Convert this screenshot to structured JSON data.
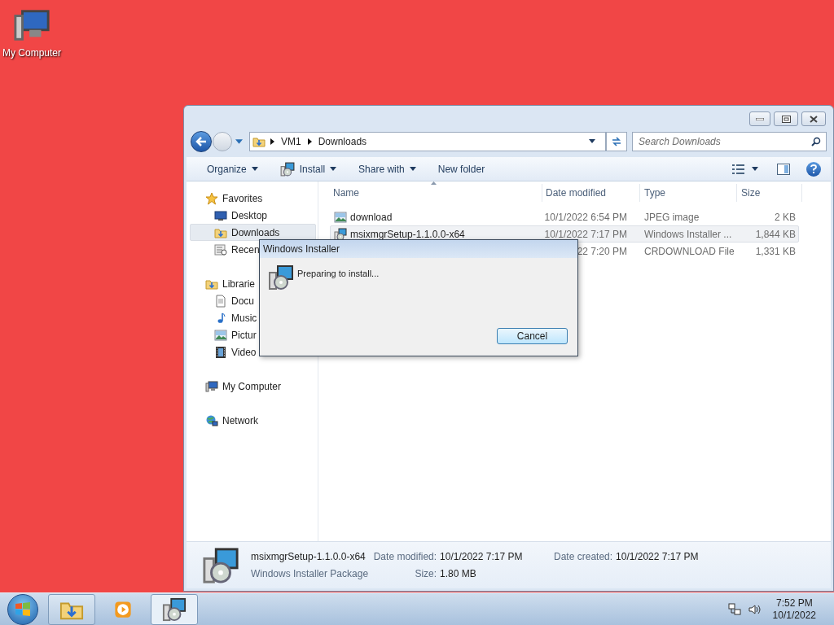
{
  "desktop": {
    "icons": [
      {
        "label": "My Computer",
        "kind": "computer"
      }
    ]
  },
  "explorer": {
    "address": [
      "VM1",
      "Downloads"
    ],
    "search": {
      "placeholder": "Search Downloads"
    },
    "toolbar": [
      {
        "label": "Organize",
        "kind": "menu"
      },
      {
        "label": "Install",
        "kind": "install"
      },
      {
        "label": "Share with",
        "kind": "menu"
      },
      {
        "label": "New folder",
        "kind": "plain"
      }
    ],
    "sidebar": [
      {
        "label": "Favorites",
        "kind": "star",
        "selected": false,
        "children": [
          {
            "label": "Desktop",
            "kind": "desktop",
            "selected": false
          },
          {
            "label": "Downloads",
            "kind": "downloads",
            "selected": true
          },
          {
            "label": "Recen",
            "kind": "recent",
            "selected": false
          }
        ]
      },
      {
        "label": "Librarie",
        "kind": "library",
        "selected": false,
        "children": [
          {
            "label": "Docu",
            "kind": "documents",
            "selected": false
          },
          {
            "label": "Music",
            "kind": "music",
            "selected": false
          },
          {
            "label": "Pictur",
            "kind": "pictures",
            "selected": false
          },
          {
            "label": "Video",
            "kind": "videos",
            "selected": false
          }
        ]
      },
      {
        "label": "My Computer",
        "kind": "computer",
        "selected": false
      },
      {
        "label": "Network",
        "kind": "network",
        "selected": false
      }
    ],
    "columns": [
      "Name",
      "Date modified",
      "Type",
      "Size"
    ],
    "rows": [
      {
        "name": "download",
        "kind": "image",
        "date": "10/1/2022 6:54 PM",
        "type": "JPEG image",
        "size": "2 KB",
        "selected": false
      },
      {
        "name": "msixmgrSetup-1.1.0.0-x64",
        "kind": "installer",
        "date": "10/1/2022 7:17 PM",
        "type": "Windows Installer ...",
        "size": "1,844 KB",
        "selected": true
      },
      {
        "date": "22 7:20 PM",
        "type": "CRDOWNLOAD File",
        "size": "1,331 KB",
        "selected": false
      }
    ],
    "details": {
      "name": "msixmgrSetup-1.1.0.0-x64",
      "type": "Windows Installer Package",
      "fields": [
        {
          "label": "Date modified:",
          "value": "10/1/2022 7:17 PM"
        },
        {
          "label": "Date created:",
          "value": "10/1/2022 7:17 PM"
        },
        {
          "label": "Size:",
          "value": "1.80 MB"
        }
      ]
    }
  },
  "dialog": {
    "title": "Windows Installer",
    "message": "Preparing to install...",
    "buttons": [
      "Cancel"
    ]
  },
  "taskbar": {
    "apps": [
      {
        "kind": "explorer",
        "open": true,
        "selected": false
      },
      {
        "kind": "media",
        "open": false,
        "selected": false
      },
      {
        "kind": "installer",
        "open": true,
        "selected": true
      }
    ],
    "time": "7:52 PM",
    "date": "10/1/2022"
  }
}
